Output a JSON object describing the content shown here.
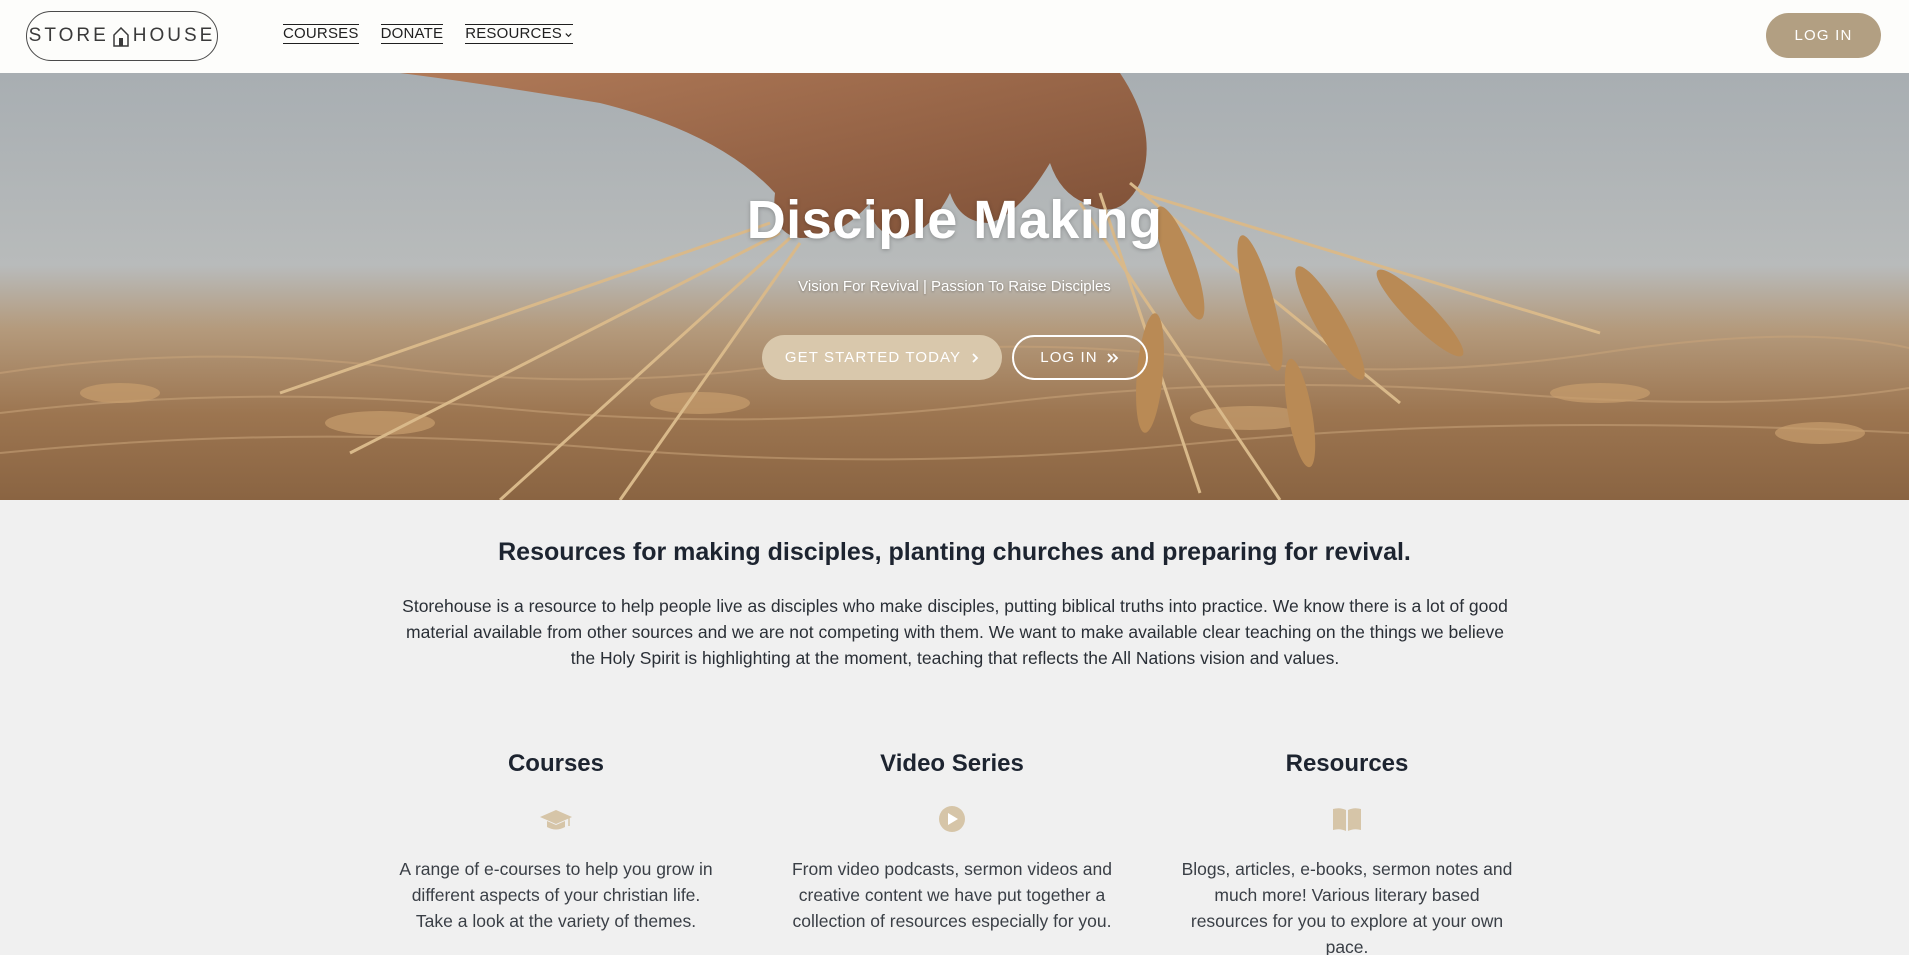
{
  "header": {
    "logo_text_left": "STORE",
    "logo_text_right": "HOUSE",
    "nav": [
      {
        "label": "COURSES"
      },
      {
        "label": "DONATE"
      },
      {
        "label": "RESOURCES"
      }
    ],
    "login_label": "LOG IN"
  },
  "hero": {
    "title": "Disciple Making",
    "subtitle": "Vision For Revival | Passion To Raise Disciples",
    "start_label": "GET STARTED TODAY",
    "login_label": "LOG IN"
  },
  "intro": {
    "heading": "Resources for making disciples, planting churches and preparing for revival.",
    "lines": [
      "Storehouse is a resource to help people live as disciples who make disciples, putting biblical truths into practice. We know there is a lot of good",
      "material available from other sources and we are not competing with them. We want to make available clear teaching on the things we believe",
      "the Holy Spirit is highlighting at the moment, teaching that reflects the All Nations vision and values."
    ]
  },
  "columns": [
    {
      "title": "Courses",
      "icon": "graduation-cap-icon",
      "lines": [
        "A range of e-courses to help you grow in",
        "different aspects of your christian life.",
        "Take a look at the variety of themes."
      ]
    },
    {
      "title": "Video Series",
      "icon": "play-circle-icon",
      "lines": [
        "From video podcasts, sermon videos and",
        "creative content we have put together a",
        "collection of resources especially for you."
      ]
    },
    {
      "title": "Resources",
      "icon": "open-book-icon",
      "lines": [
        "Blogs, articles, e-books, sermon notes and",
        "much more! Various literary based",
        "resources for you to explore at your own",
        "pace."
      ]
    }
  ],
  "colors": {
    "accent": "#b29f82",
    "accent_light": "#d9c8ac",
    "icon": "#d6c5a8",
    "heading": "#1d2430",
    "background": "#f0f0f0"
  }
}
